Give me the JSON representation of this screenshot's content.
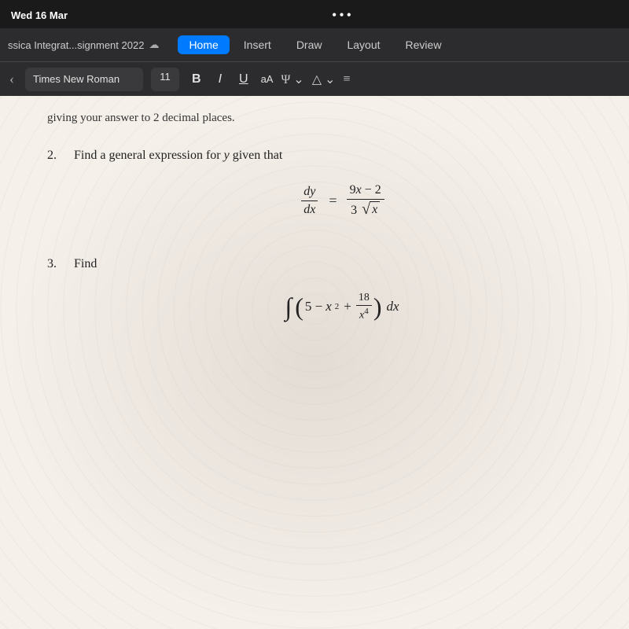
{
  "status_bar": {
    "time": "Wed 16 Mar",
    "dots": "•••"
  },
  "tab_bar": {
    "doc_title": "ssica Integrat...signment 2022",
    "cloud_icon": "☁",
    "nav_items": [
      {
        "label": "Home",
        "active": true
      },
      {
        "label": "Insert",
        "active": false
      },
      {
        "label": "Draw",
        "active": false
      },
      {
        "label": "Layout",
        "active": false
      },
      {
        "label": "Review",
        "active": false
      }
    ]
  },
  "formatting_bar": {
    "font_name": "Times New Roman",
    "font_size": "11",
    "bold_label": "B",
    "italic_label": "I",
    "underline_label": "U",
    "aa_label": "aA",
    "paragraph_icon": "≡"
  },
  "document": {
    "intro_text": "giving your answer to 2 decimal places.",
    "questions": [
      {
        "number": "2.",
        "text": "Find a general expression for y given that",
        "math_description": "dy/dx = (9x - 2) / (3 sqrt(x))"
      },
      {
        "number": "3.",
        "text": "Find",
        "math_description": "integral of (5 - x^2 + 18/x^4) dx"
      }
    ]
  }
}
